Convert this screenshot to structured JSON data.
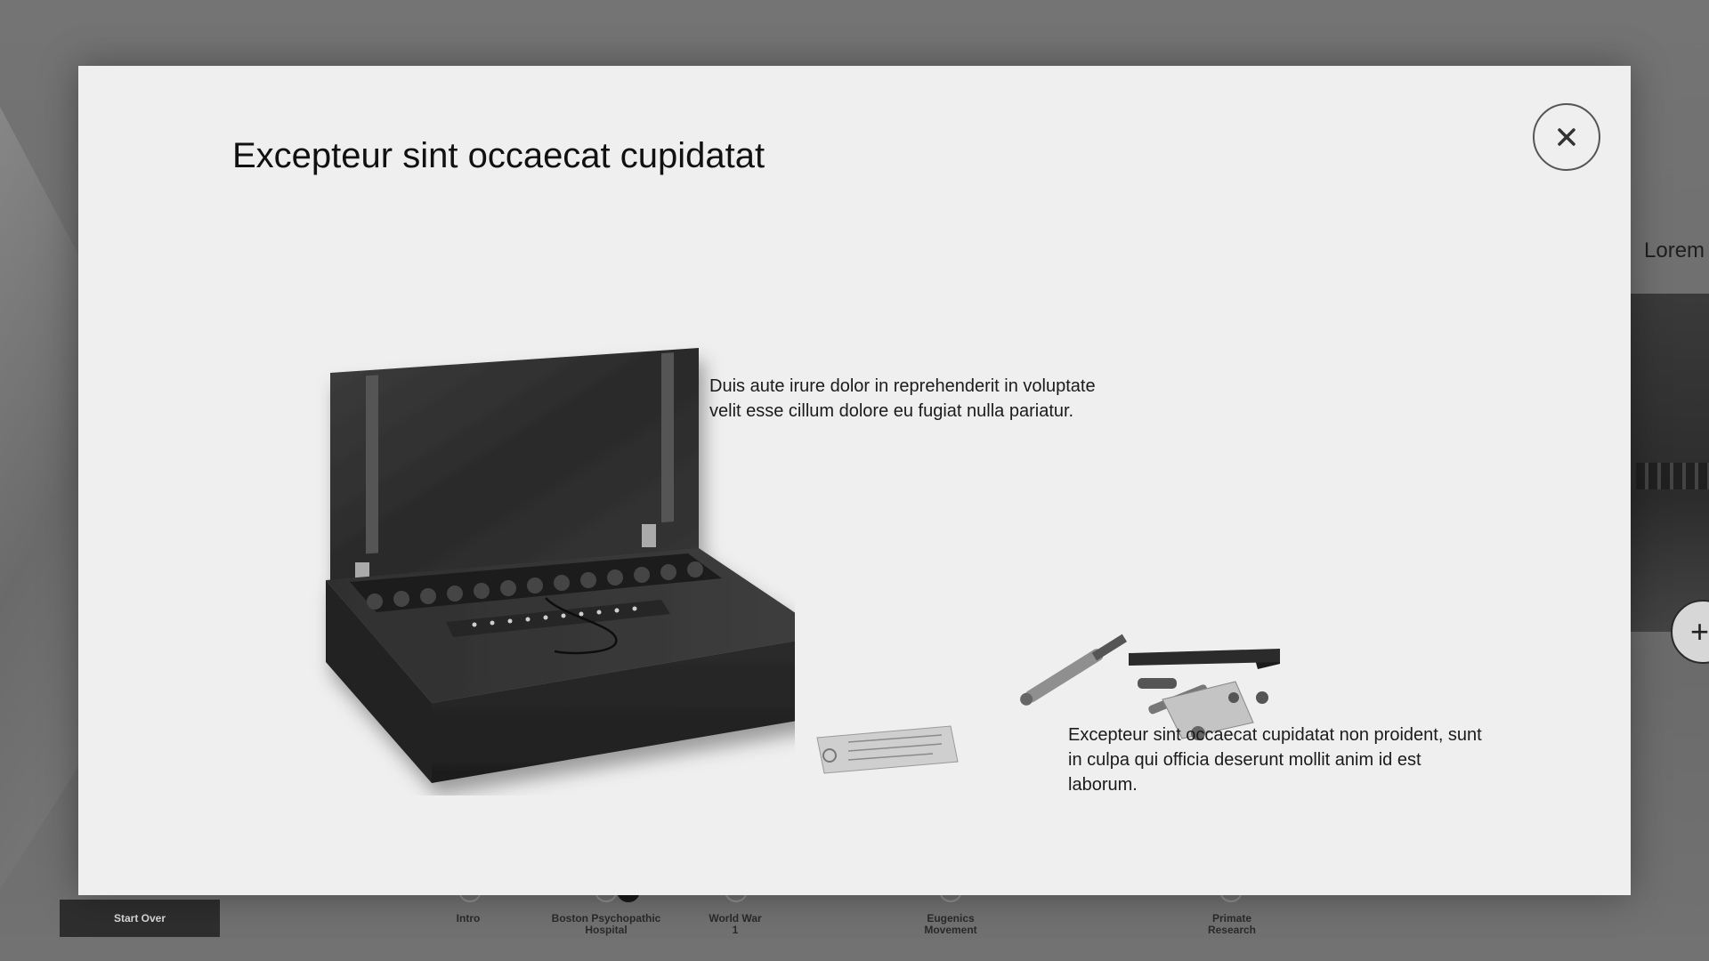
{
  "modal": {
    "title": "Excepteur sint occaecat cupidatat",
    "caption_1": "Duis aute irure dolor in reprehenderit in voluptate velit esse cillum dolore eu fugiat nulla pariatur.",
    "caption_2": "Excepteur sint occaecat cupidatat non proident, sunt in culpa qui officia deserunt mollit anim id est laborum.",
    "close_icon": "close-icon"
  },
  "background": {
    "right_label": "Lorem",
    "plus_icon": "plus-icon"
  },
  "footer": {
    "start_over_label": "Start Over",
    "timeline": [
      {
        "label": "Intro"
      },
      {
        "label": "Boston Psychopathic Hospital"
      },
      {
        "label": "World War 1"
      },
      {
        "label": "Eugenics Movement"
      },
      {
        "label": "Primate Research"
      }
    ]
  }
}
